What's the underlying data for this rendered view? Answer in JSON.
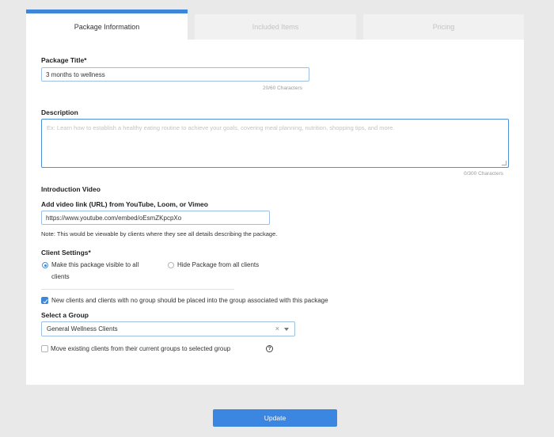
{
  "tabs": [
    {
      "label": "Package Information",
      "active": true
    },
    {
      "label": "Included Items",
      "active": false
    },
    {
      "label": "Pricing",
      "active": false
    }
  ],
  "package_title": {
    "label": "Package Title*",
    "value": "3 months to wellness",
    "counter": "20/60 Characters"
  },
  "description": {
    "label": "Description",
    "placeholder": "Ex: Learn how to establish a healthy eating routine to achieve your goals, covering meal planning, nutrition, shopping tips, and more.",
    "counter": "0/300 Characters"
  },
  "intro_video": {
    "heading": "Introduction Video",
    "label": "Add video link (URL) from YouTube, Loom, or Vimeo",
    "value": "https://www.youtube.com/embed/oEsmZKpcpXo",
    "note": "Note: This would be viewable by clients where they see all details describing the package."
  },
  "client_settings": {
    "label": "Client Settings*",
    "option_visible_line1": "Make this package visible to all",
    "option_visible_line2": "clients",
    "option_hide": "Hide Package from all clients",
    "selected": "visible"
  },
  "group_assign": {
    "checkbox_label": "New clients and clients with no group should be placed into the group associated with this package",
    "checked": true
  },
  "select_group": {
    "label": "Select a Group",
    "value": "General Wellness Clients",
    "clear_symbol": "×"
  },
  "move_clients": {
    "checkbox_label": "Move existing clients from their current groups to selected group",
    "checked": false,
    "help_symbol": "?"
  },
  "update_button": {
    "label": "Update"
  },
  "colors": {
    "accent": "#3d86d8",
    "button": "#3b86e0",
    "page_bg": "#e9e9e9"
  }
}
